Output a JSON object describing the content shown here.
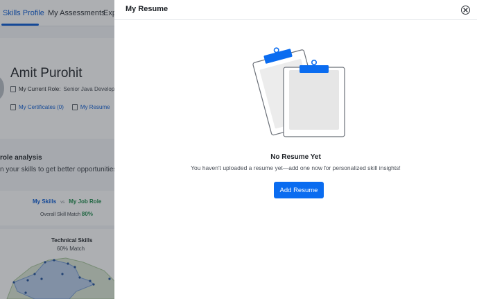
{
  "background": {
    "tabs": [
      {
        "label": "Skills Profile",
        "active": true
      },
      {
        "label": "My Assessments",
        "active": false
      },
      {
        "label": "Expl",
        "active": false
      }
    ],
    "profile": {
      "name": "Amit Purohit",
      "role_label": "My Current Role:",
      "role_value": "Senior Java Developer",
      "certificates_link": "My Certificates (0)",
      "resume_link": "My Resume"
    },
    "role_analysis": {
      "title": "role analysis",
      "subtitle": "n your skills to get better opportunities"
    },
    "comparison": {
      "left_label": "My Skills",
      "vs_label": "vs",
      "right_label": "My Job Role",
      "match_label": "Overall Skill Match",
      "match_value": "80%"
    },
    "technical_skills": {
      "title": "Technical Skills",
      "match": "60% Match"
    }
  },
  "drawer": {
    "title": "My Resume",
    "empty_title": "No Resume Yet",
    "empty_message": "You haven't uploaded a resume yet—add one now for personalized skill insights!",
    "add_button_label": "Add Resume"
  },
  "colors": {
    "accent": "#0a6cf0",
    "link": "#0a5bd3",
    "match_green": "#1c8a4b",
    "overlay": "rgba(40,44,52,0.38)"
  }
}
